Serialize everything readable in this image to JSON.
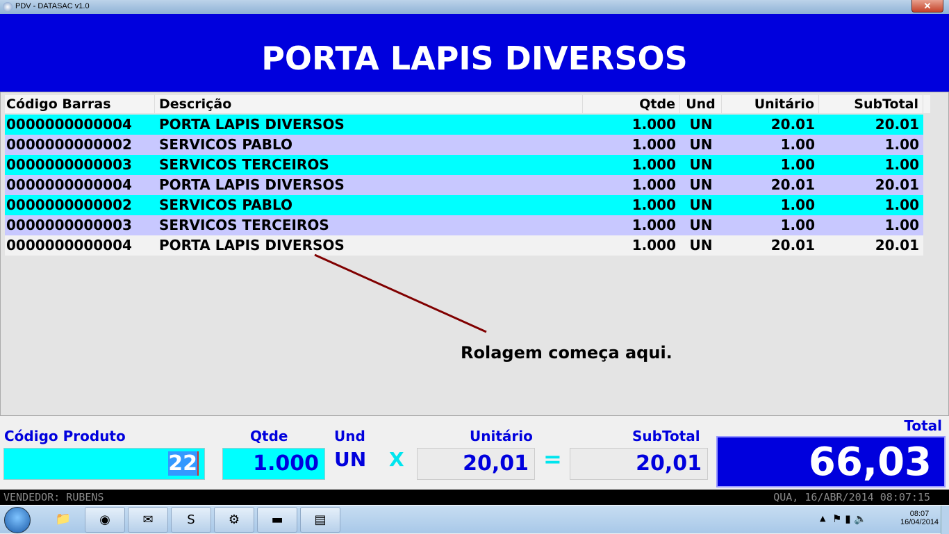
{
  "window": {
    "title": "PDV - DATASAC v1.0",
    "close": "✕"
  },
  "header": {
    "product": "PORTA LAPIS DIVERSOS"
  },
  "grid": {
    "columns": [
      "Código Barras",
      "Descrição",
      "Qtde",
      "Und",
      "Unitário",
      "SubTotal"
    ],
    "rows": [
      [
        "0000000000004",
        "PORTA LAPIS DIVERSOS",
        "1.000",
        "UN",
        "20.01",
        "20.01"
      ],
      [
        "0000000000002",
        "SERVICOS PABLO",
        "1.000",
        "UN",
        "1.00",
        "1.00"
      ],
      [
        "0000000000003",
        "SERVICOS TERCEIROS",
        "1.000",
        "UN",
        "1.00",
        "1.00"
      ],
      [
        "0000000000004",
        "PORTA LAPIS DIVERSOS",
        "1.000",
        "UN",
        "20.01",
        "20.01"
      ],
      [
        "0000000000002",
        "SERVICOS PABLO",
        "1.000",
        "UN",
        "1.00",
        "1.00"
      ],
      [
        "0000000000003",
        "SERVICOS TERCEIROS",
        "1.000",
        "UN",
        "1.00",
        "1.00"
      ],
      [
        "0000000000004",
        "PORTA LAPIS DIVERSOS",
        "1.000",
        "UN",
        "20.01",
        "20.01"
      ]
    ],
    "row_colors": [
      "#00ffff",
      "#c8c8ff",
      "#00ffff",
      "#c8c8ff",
      "#00ffff",
      "#c8c8ff",
      "#f2f2f2"
    ]
  },
  "annotation": "Rolagem começa aqui.",
  "entry": {
    "codigo_label": "Código Produto",
    "codigo_value": "22",
    "qtde_label": "Qtde",
    "qtde_value": "1.000",
    "und_label": "Und",
    "und_value": "UN",
    "times": "X",
    "unitario_label": "Unitário",
    "unitario_value": "20,01",
    "equals": "=",
    "subtotal_label": "SubTotal",
    "subtotal_value": "20,01",
    "total_label": "Total",
    "total_value": "66,03"
  },
  "status": {
    "vendedor": "VENDEDOR: RUBENS",
    "datetime": "QUA, 16/ABR/2014 08:07:15"
  },
  "taskbar": {
    "time": "08:07",
    "date": "16/04/2014",
    "apps": [
      "explorer-icon",
      "chrome-icon",
      "outlook-icon",
      "skype-icon",
      "tools-icon",
      "cmd-icon",
      "window-app-icon"
    ]
  }
}
